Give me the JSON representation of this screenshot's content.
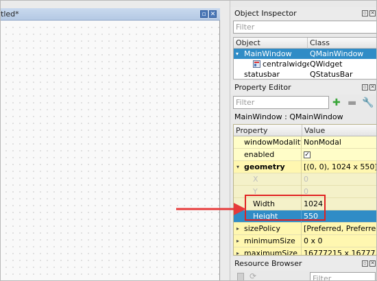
{
  "form": {
    "title": "tled*",
    "btn_float": "▫",
    "btn_close": "✕"
  },
  "object_inspector": {
    "title": "Object Inspector",
    "filter_placeholder": "Filter",
    "columns": [
      "Object",
      "Class"
    ],
    "rows": [
      {
        "object": "MainWindow",
        "class": "QMainWindow",
        "expander": "▾"
      },
      {
        "object": "centralwidget",
        "class": "QWidget"
      },
      {
        "object": "statusbar",
        "class": "QStatusBar"
      }
    ]
  },
  "property_editor": {
    "title": "Property Editor",
    "filter_placeholder": "Filter",
    "context": "MainWindow : QMainWindow",
    "columns": [
      "Property",
      "Value"
    ],
    "rows": [
      {
        "name": "windowModality",
        "value": "NonModal"
      },
      {
        "name": "enabled",
        "value": "✓"
      },
      {
        "name": "geometry",
        "value": "[(0, 0), 1024 x 550]",
        "expander": "▾"
      },
      {
        "name": "X",
        "value": "0"
      },
      {
        "name": "Y",
        "value": "0"
      },
      {
        "name": "Width",
        "value": "1024"
      },
      {
        "name": "Height",
        "value": "550"
      },
      {
        "name": "sizePolicy",
        "value": "[Preferred, Preferre...",
        "expander": "▸"
      },
      {
        "name": "minimumSize",
        "value": "0 x 0",
        "expander": "▸"
      },
      {
        "name": "maximumSize",
        "value": "16777215 x 16777...",
        "expander": "▸"
      }
    ]
  },
  "resource_browser": {
    "title": "Resource Browser",
    "filter_placeholder": "Filter"
  },
  "colors": {
    "selection": "#308cc6",
    "highlight_box": "#e02020",
    "arrow": "#e63a3a"
  }
}
